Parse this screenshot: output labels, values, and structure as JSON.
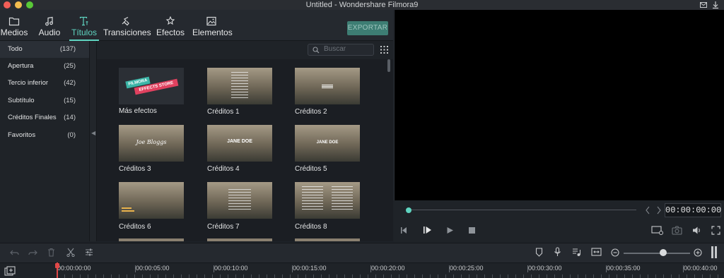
{
  "window": {
    "title": "Untitled - Wondershare Filmora9"
  },
  "tabs": [
    {
      "label": "Medios",
      "icon": "folder-icon"
    },
    {
      "label": "Audio",
      "icon": "music-note-icon"
    },
    {
      "label": "Títulos",
      "icon": "text-icon",
      "active": true
    },
    {
      "label": "Transiciones",
      "icon": "transition-icon"
    },
    {
      "label": "Efectos",
      "icon": "effects-icon"
    },
    {
      "label": "Elementos",
      "icon": "image-icon"
    }
  ],
  "export_label": "EXPORTAR",
  "categories": [
    {
      "name": "Todo",
      "count": "(137)",
      "active": true
    },
    {
      "name": "Apertura",
      "count": "(25)"
    },
    {
      "name": "Tercio inferior",
      "count": "(42)"
    },
    {
      "name": "Subtítulo",
      "count": "(15)"
    },
    {
      "name": "Créditos Finales",
      "count": "(14)"
    },
    {
      "name": "Favoritos",
      "count": "(0)"
    }
  ],
  "search": {
    "placeholder": "Buscar"
  },
  "store_banner": {
    "line1": "FILMORA",
    "line2": "EFFECTS STORE"
  },
  "thumbnails": [
    {
      "label": "Más efectos"
    },
    {
      "label": "Créditos 1"
    },
    {
      "label": "Créditos 2"
    },
    {
      "label": "Créditos 3",
      "overlay": "Joe Bloggs"
    },
    {
      "label": "Créditos 4",
      "overlay": "JANE DOE"
    },
    {
      "label": "Créditos 5",
      "overlay": "JANE DOE"
    },
    {
      "label": "Créditos 6"
    },
    {
      "label": "Créditos 7"
    },
    {
      "label": "Créditos 8"
    }
  ],
  "player": {
    "timecode": "00:00:00:00",
    "progress": 0
  },
  "timeline": {
    "zoom_level": 0.55,
    "ruler": [
      "00:00:00:00",
      "00:00:05:00",
      "00:00:10:00",
      "00:00:15:00",
      "00:00:20:00",
      "00:00:25:00",
      "00:00:30:00",
      "00:00:35:00",
      "00:00:40:00"
    ]
  },
  "colors": {
    "accent": "#5fd4c0",
    "export_bg": "#3d7d73",
    "playhead": "#e04848"
  }
}
